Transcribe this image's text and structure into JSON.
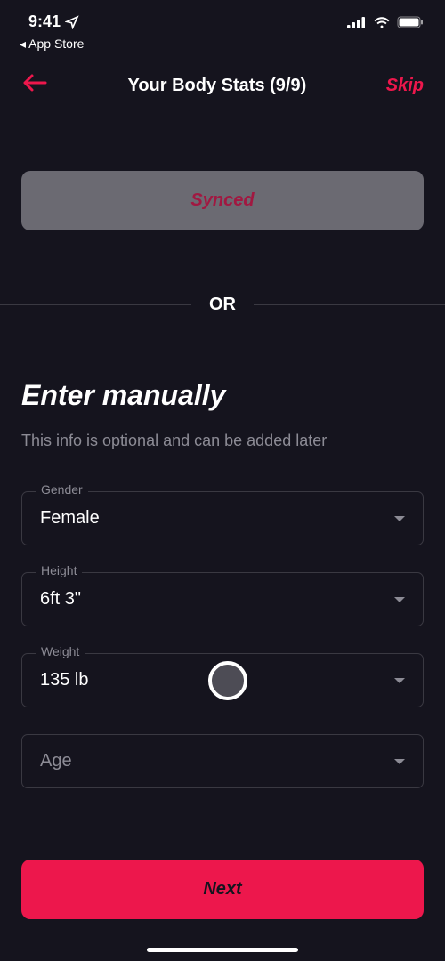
{
  "status": {
    "time": "9:41",
    "back_app": "App Store"
  },
  "header": {
    "title": "Your Body Stats (9/9)",
    "skip": "Skip"
  },
  "synced": {
    "label": "Synced"
  },
  "divider": {
    "text": "OR"
  },
  "manual": {
    "heading": "Enter manually",
    "subtext": "This info is optional and can be added later"
  },
  "fields": {
    "gender": {
      "label": "Gender",
      "value": "Female"
    },
    "height": {
      "label": "Height",
      "value": "6ft 3\""
    },
    "weight": {
      "label": "Weight",
      "value": "135 lb"
    },
    "age": {
      "placeholder": "Age"
    }
  },
  "next": {
    "label": "Next"
  }
}
